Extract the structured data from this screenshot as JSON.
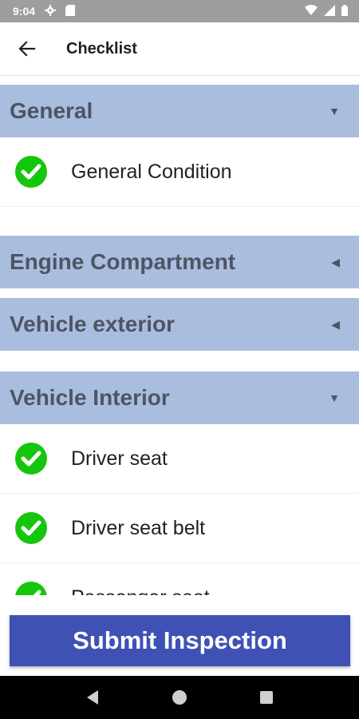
{
  "status_bar": {
    "time": "9:04",
    "icons": [
      "settings-icon",
      "sd-card-icon",
      "wifi-icon",
      "signal-icon",
      "battery-icon"
    ]
  },
  "app_bar": {
    "title": "Checklist",
    "back_icon": "arrow-left-icon"
  },
  "sections": [
    {
      "title": "General",
      "expanded": true,
      "arrow": "▼",
      "items": [
        {
          "label": "General Condition",
          "checked": true
        }
      ]
    },
    {
      "title": "Engine Compartment",
      "expanded": false,
      "arrow": "◀",
      "items": []
    },
    {
      "title": "Vehicle exterior",
      "expanded": false,
      "arrow": "◀",
      "items": []
    },
    {
      "title": "Vehicle Interior",
      "expanded": true,
      "arrow": "▼",
      "items": [
        {
          "label": "Driver seat",
          "checked": true
        },
        {
          "label": "Driver seat belt",
          "checked": true
        },
        {
          "label": "Passenger seat",
          "checked": true
        }
      ]
    }
  ],
  "submit_label": "Submit Inspection",
  "colors": {
    "status_bar": "#9e9e9e",
    "section_header": "#a9bddf",
    "section_title": "#4d5563",
    "check_green": "#16c60c",
    "submit_button": "#3f51b5",
    "nav_bar": "#000000"
  },
  "nav_bar": {
    "buttons": [
      "back-triangle-icon",
      "home-circle-icon",
      "recents-square-icon"
    ]
  }
}
